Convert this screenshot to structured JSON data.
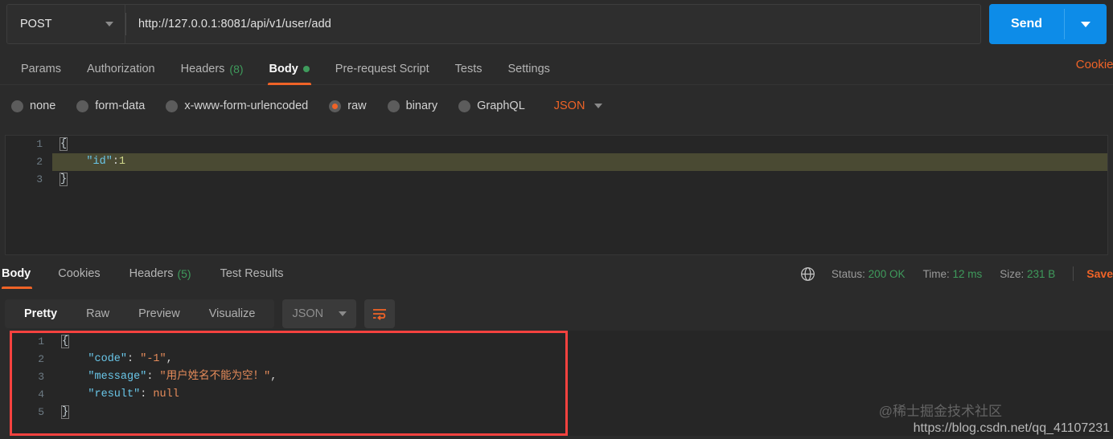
{
  "request_bar": {
    "method": "POST",
    "method_caret_icon": "chevron-down-icon",
    "url": "http://127.0.0.1:8081/api/v1/user/add",
    "send_label": "Send",
    "send_caret_icon": "chevron-down-icon",
    "send_color": "#0d8ce8"
  },
  "request_tabs": {
    "items": [
      {
        "label": "Params",
        "count": "",
        "active": false
      },
      {
        "label": "Authorization",
        "count": "",
        "active": false
      },
      {
        "label": "Headers",
        "count": "(8)",
        "active": false
      },
      {
        "label": "Body",
        "count": "",
        "active": true
      },
      {
        "label": "Pre-request Script",
        "count": "",
        "active": false
      },
      {
        "label": "Tests",
        "count": "",
        "active": false
      },
      {
        "label": "Settings",
        "count": "",
        "active": false
      }
    ],
    "cookies_edge_label": "Cookies",
    "active_underline_color": "#ef6327",
    "count_color": "#3f9b5c"
  },
  "body_type": {
    "options": [
      {
        "label": "none",
        "selected": false
      },
      {
        "label": "form-data",
        "selected": false
      },
      {
        "label": "x-www-form-urlencoded",
        "selected": false
      },
      {
        "label": "raw",
        "selected": true
      },
      {
        "label": "binary",
        "selected": false
      },
      {
        "label": "GraphQL",
        "selected": false
      }
    ],
    "format": "JSON",
    "format_caret_icon": "chevron-down-icon",
    "selected_color": "#ef6327"
  },
  "request_editor": {
    "line_numbers": [
      "1",
      "2",
      "3"
    ],
    "highlighted_line": 2,
    "lines": [
      [
        {
          "t": "{",
          "c": "brace"
        }
      ],
      [
        {
          "t": "    ",
          "c": "punc"
        },
        {
          "t": "\"id\"",
          "c": "key"
        },
        {
          "t": ":",
          "c": "punc"
        },
        {
          "t": "1",
          "c": "num"
        }
      ],
      [
        {
          "t": "}",
          "c": "brace"
        }
      ]
    ],
    "raw_text": "{\n    \"id\":1\n}"
  },
  "response_tabs": {
    "items": [
      {
        "label": "Body",
        "count": "",
        "active": true
      },
      {
        "label": "Cookies",
        "count": "",
        "active": false
      },
      {
        "label": "Headers",
        "count": "(5)",
        "active": false
      },
      {
        "label": "Test Results",
        "count": "",
        "active": false
      }
    ]
  },
  "response_meta": {
    "globe_icon": "globe-icon",
    "status_label": "Status:",
    "status_value": "200 OK",
    "time_label": "Time:",
    "time_value": "12 ms",
    "size_label": "Size:",
    "size_value": "231 B",
    "save_label": "Save",
    "value_color": "#3f9b5c"
  },
  "response_toolbar": {
    "views": [
      {
        "label": "Pretty",
        "active": true
      },
      {
        "label": "Raw",
        "active": false
      },
      {
        "label": "Preview",
        "active": false
      },
      {
        "label": "Visualize",
        "active": false
      }
    ],
    "format": "JSON",
    "format_caret_icon": "chevron-down-icon",
    "wrap_icon": "word-wrap-icon"
  },
  "response_editor": {
    "line_numbers": [
      "1",
      "2",
      "3",
      "4",
      "5"
    ],
    "highlight_box_color": "#f6423f",
    "lines": [
      [
        {
          "t": "{",
          "c": "brace"
        }
      ],
      [
        {
          "t": "    ",
          "c": "punc"
        },
        {
          "t": "\"code\"",
          "c": "key"
        },
        {
          "t": ": ",
          "c": "punc"
        },
        {
          "t": "\"-1\"",
          "c": "str"
        },
        {
          "t": ",",
          "c": "punc"
        }
      ],
      [
        {
          "t": "    ",
          "c": "punc"
        },
        {
          "t": "\"message\"",
          "c": "key"
        },
        {
          "t": ": ",
          "c": "punc"
        },
        {
          "t": "\"用户姓名不能为空！\"",
          "c": "str"
        },
        {
          "t": ",",
          "c": "punc"
        }
      ],
      [
        {
          "t": "    ",
          "c": "punc"
        },
        {
          "t": "\"result\"",
          "c": "key"
        },
        {
          "t": ": ",
          "c": "punc"
        },
        {
          "t": "null",
          "c": "null"
        }
      ],
      [
        {
          "t": "}",
          "c": "brace"
        }
      ]
    ],
    "raw_text": "{\n    \"code\": \"-1\",\n    \"message\": \"用户姓名不能为空！\",\n    \"result\": null\n}"
  },
  "watermarks": {
    "community": "@稀士掘金技术社区",
    "url": "https://blog.csdn.net/qq_41107231"
  }
}
